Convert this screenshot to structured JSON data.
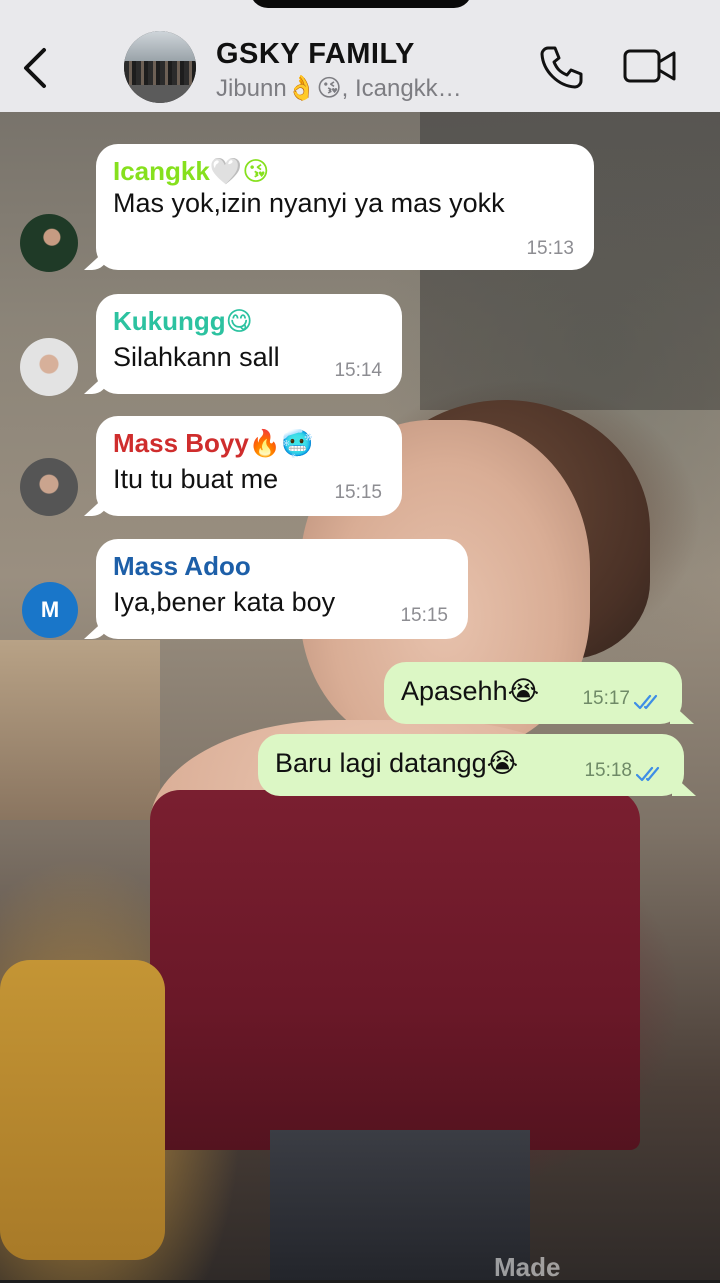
{
  "header": {
    "title": "GSKY FAMILY",
    "subtitle": "Jibunn👌😘, Icangkk…"
  },
  "messages": [
    {
      "sender": "Icangkk🤍😘",
      "sender_color": "#86e01d",
      "text": "Mas yok,izin nyanyi ya mas yokk",
      "time": "15:13",
      "direction": "in"
    },
    {
      "sender": "Kukungg😋",
      "sender_color": "#2cc2a0",
      "text": "Silahkann sall",
      "time": "15:14",
      "direction": "in"
    },
    {
      "sender": "Mass Boyy🔥🥶",
      "sender_color": "#cf2d2d",
      "text": "Itu tu buat me",
      "time": "15:15",
      "direction": "in"
    },
    {
      "sender": "Mass Adoo",
      "sender_color": "#1d5fa8",
      "avatar_letter": "M",
      "text": "Iya,bener kata boy",
      "time": "15:15",
      "direction": "in"
    },
    {
      "text": "Apasehh😭",
      "time": "15:17",
      "direction": "out",
      "status": "read"
    },
    {
      "text": "Baru lagi datangg😭",
      "time": "15:18",
      "direction": "out",
      "status": "read"
    }
  ],
  "watermark": "Made",
  "colors": {
    "header_bg": "#e9e9ec",
    "incoming_bubble": "#ffffff",
    "outgoing_bubble": "#dcf7c5",
    "read_ticks": "#3e8ee6"
  },
  "icons": [
    "back-chevron-icon",
    "phone-icon",
    "video-camera-icon",
    "double-check-icon"
  ]
}
